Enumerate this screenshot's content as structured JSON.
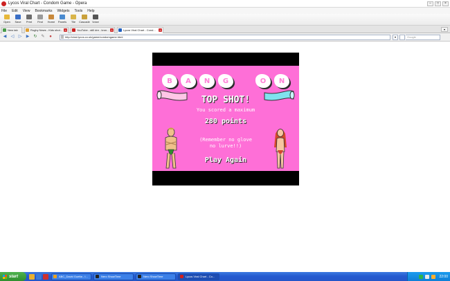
{
  "window": {
    "title": "Lycos Viral Chart - Condom Game - Opera"
  },
  "menu": [
    "File",
    "Edit",
    "View",
    "Bookmarks",
    "Widgets",
    "Tools",
    "Help"
  ],
  "toolbar": [
    {
      "label": "Open",
      "icon": "folder-icon",
      "color": "#e7b83a"
    },
    {
      "label": "Save",
      "icon": "save-icon",
      "color": "#3b6fc6"
    },
    {
      "label": "Print",
      "icon": "print-icon",
      "color": "#6c6c6c"
    },
    {
      "label": "Find",
      "icon": "find-icon",
      "color": "#9a9a9a"
    },
    {
      "label": "Home",
      "icon": "home-icon",
      "color": "#c8893b"
    },
    {
      "label": "Panels",
      "icon": "panels-icon",
      "color": "#4a8bd0"
    },
    {
      "label": "Tile",
      "icon": "tile-icon",
      "color": "#d9b54a"
    },
    {
      "label": "Cascade",
      "icon": "cascade-icon",
      "color": "#c9a13c"
    },
    {
      "label": "Voice",
      "icon": "voice-icon",
      "color": "#555555"
    }
  ],
  "tabs": [
    {
      "label": "New tab",
      "color": "#4a9c4a",
      "active": false
    },
    {
      "label": "Rugby News - Kids shot...",
      "color": "#e0a030",
      "active": false
    },
    {
      "label": "YouTube - still dre - kron...",
      "color": "#cc2020",
      "active": false
    },
    {
      "label": "Lycos Viral Chart - Cond...",
      "color": "#2060c0",
      "active": true
    }
  ],
  "address": {
    "url": "http://viral.lycos.co.uk/game/condomgame.html",
    "search_placeholder": "Google"
  },
  "game": {
    "bang_letters": [
      "B",
      "A",
      "N",
      "G",
      "",
      "O",
      "N"
    ],
    "headline": "TOP SHOT!",
    "scored_text": "You scored a maximum",
    "points_text": "280 points",
    "remember_line1": "(Remember no glove",
    "remember_line2": "no lurve!!)",
    "play_again": "Play Again",
    "colors": {
      "background": "#fe6fd7",
      "banner_left": "#ffc6e6",
      "banner_right": "#7fe3ee"
    }
  },
  "taskbar": {
    "start_label": "start",
    "tasks": [
      {
        "label": "ABC_David Guetta - I...",
        "color": "#e8a020",
        "active": false
      },
      {
        "label": "Nero ShowTime",
        "color": "#222222",
        "active": false
      },
      {
        "label": "Nero ShowTime",
        "color": "#222222",
        "active": false
      },
      {
        "label": "Lycos Viral Chart - Co...",
        "color": "#cc2020",
        "active": true
      }
    ],
    "clock": "22:00"
  }
}
